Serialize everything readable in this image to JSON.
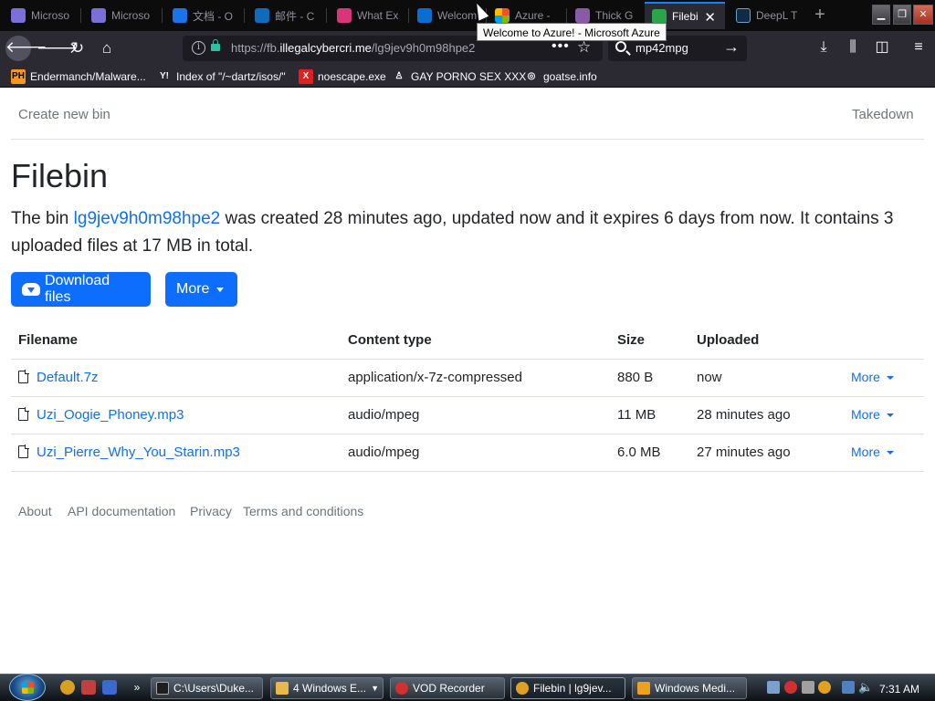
{
  "browser": {
    "tabs": [
      {
        "title": "Microso",
        "favicon_color": "#7b6fd9"
      },
      {
        "title": "Microso",
        "favicon_color": "#7b6fd9"
      },
      {
        "title": "文档 - O",
        "favicon_color": "#1a73e8"
      },
      {
        "title": "邮件 - C",
        "favicon_color": "#0f6cbd"
      },
      {
        "title": "What Ex",
        "favicon_color": "#d9357a"
      },
      {
        "title": "Welcom",
        "favicon_color": "#0a6ed1"
      },
      {
        "title": "Azure -",
        "favicon_color": "#f25022"
      },
      {
        "title": "Thick G",
        "favicon_color": "#8a5aa8"
      },
      {
        "title": "Filebi",
        "favicon_color": "#2ca44a",
        "active": true
      },
      {
        "title": "DeepL T",
        "favicon_color": "#0f2b46"
      }
    ],
    "tooltip": "Welcome to Azure! - Microsoft Azure",
    "url": {
      "prefix": "https://fb.",
      "domain": "illegalcybercri.me",
      "path": "/lg9jev9h0m98hpe2"
    },
    "search_value": "mp42mpg",
    "bookmarks": [
      {
        "label": "Endermanch/Malware...",
        "icon": "PH",
        "icon_bg": "#f7971d",
        "icon_color": "#000000"
      },
      {
        "label": "Index of \"/~dartz/isos/\"",
        "icon": "Y!",
        "icon_bg": "#2b2a33",
        "icon_color": "#ffffff"
      },
      {
        "label": "noescape.exe",
        "icon": "X",
        "icon_bg": "#e02020",
        "icon_color": "#ffffff"
      },
      {
        "label": "GAY PORNO SEX XXX",
        "icon": "♙",
        "icon_bg": "#2b2a33",
        "icon_color": "#ffffff"
      },
      {
        "label": "goatse.info",
        "icon": "◎",
        "icon_bg": "#2b2a33",
        "icon_color": "#ffffff"
      }
    ]
  },
  "page": {
    "nav": {
      "create": "Create new bin",
      "takedown": "Takedown"
    },
    "title": "Filebin",
    "lead": {
      "before": "The bin ",
      "bin_id": "lg9jev9h0m98hpe2",
      "after": " was created 28 minutes ago, updated now and it expires 6 days from now. It contains 3 uploaded files at 17 MB in total."
    },
    "buttons": {
      "download": "Download files",
      "more": "More"
    },
    "table": {
      "headers": [
        "Filename",
        "Content type",
        "Size",
        "Uploaded"
      ],
      "rows": [
        {
          "name": "Default.7z",
          "type": "application/x-7z-compressed",
          "size": "880 B",
          "uploaded": "now",
          "more": "More"
        },
        {
          "name": "Uzi_Oogie_Phoney.mp3",
          "type": "audio/mpeg",
          "size": "11 MB",
          "uploaded": "28 minutes ago",
          "more": "More"
        },
        {
          "name": "Uzi_Pierre_Why_You_Starin.mp3",
          "type": "audio/mpeg",
          "size": "6.0 MB",
          "uploaded": "27 minutes ago",
          "more": "More"
        }
      ]
    },
    "footer": [
      "About",
      "API documentation",
      "Privacy",
      "Terms and conditions"
    ]
  },
  "taskbar": {
    "items": [
      {
        "label": "C:\\Users\\Duke...",
        "icon_color": "#1e1e1e"
      },
      {
        "label": "4 Windows E...",
        "icon_color": "#e8b84a"
      },
      {
        "label": "VOD Recorder",
        "icon_color": "#d03030"
      },
      {
        "label": "Filebin | lg9jev...",
        "icon_color": "#e0a020",
        "active": true
      },
      {
        "label": "Windows Medi...",
        "icon_color": "#f0a020"
      }
    ],
    "clock": "7:31 AM"
  }
}
